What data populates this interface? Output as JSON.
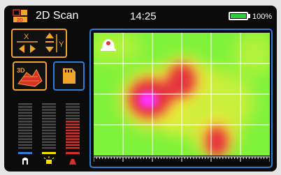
{
  "header": {
    "title": "2D Scan",
    "time": "14:25",
    "battery_percent": "100%",
    "battery_level": 1.0,
    "mode_icon_label": "2D",
    "mode_icon": "scan-mode-icon"
  },
  "left_panel": {
    "axes_button": {
      "x_label": "X",
      "y_label": "Y",
      "icon": "axis-arrows-icon"
    },
    "view3d_button": {
      "label": "3D",
      "icon": "3d-view-icon"
    },
    "sd_button": {
      "icon": "sd-card-icon"
    },
    "level_bars": [
      {
        "name": "ground",
        "icon": "probe-icon",
        "indicator_color": "#2b7fd9",
        "fill": 0.0
      },
      {
        "name": "light",
        "icon": "lamp-icon",
        "indicator_color": "#f5e000",
        "fill": 0.0
      },
      {
        "name": "signal",
        "icon": "target-icon",
        "indicator_color": "#d9302b",
        "fill": 0.6
      }
    ]
  },
  "scan": {
    "icon": "probe-position-icon",
    "colors": {
      "frame": "#2b7fd9",
      "low": "#7ef23a",
      "mid": "#f4e23a",
      "high": "#e5323c",
      "peak": "#ff33ff"
    }
  },
  "colors": {
    "accent": "#f0a52a",
    "frame_blue": "#2b7fd9",
    "battery_green": "#2ecc40"
  }
}
